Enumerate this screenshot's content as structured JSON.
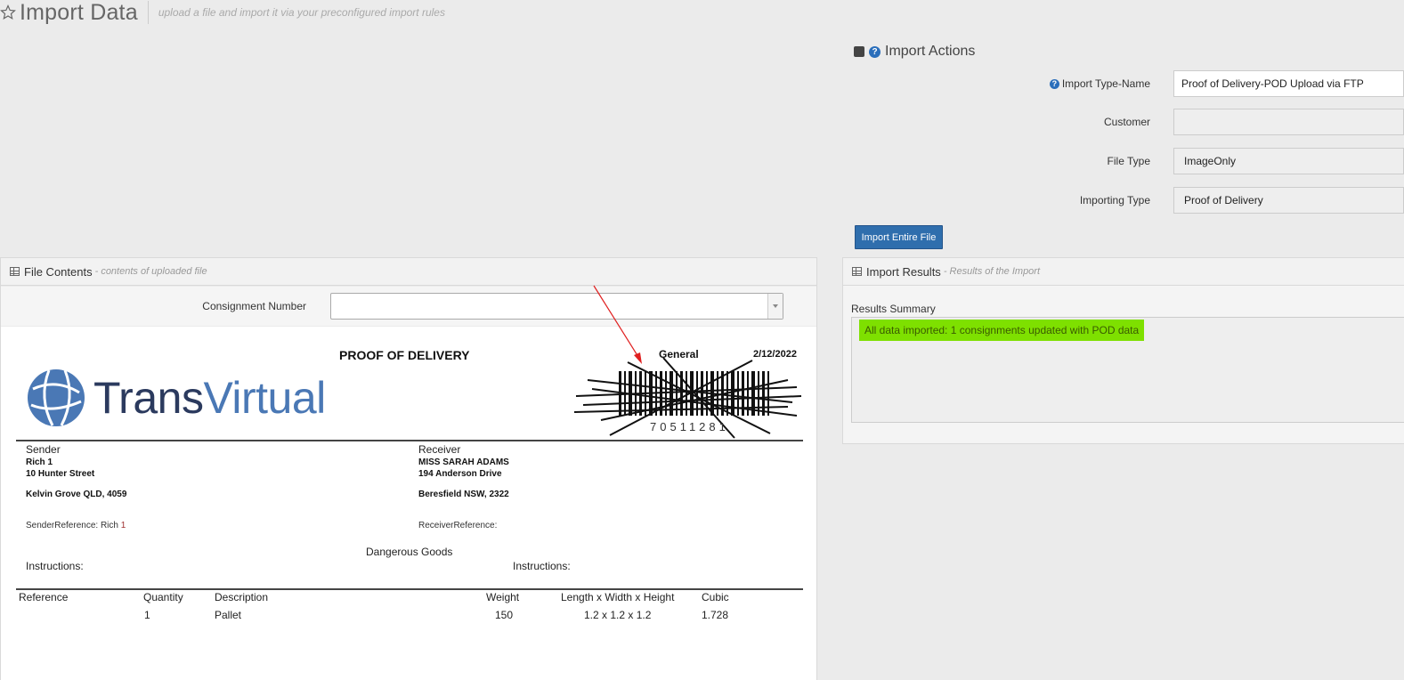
{
  "header": {
    "title": "Import Data",
    "subtitle": "upload a file and import it via your preconfigured import rules"
  },
  "actions": {
    "title": "Import Actions",
    "fields": [
      {
        "label": "Import Type-Name",
        "value": "Proof of Delivery-POD Upload via FTP"
      },
      {
        "label": "Customer",
        "value": ""
      },
      {
        "label": "File Type",
        "value": "ImageOnly"
      },
      {
        "label": "Importing Type",
        "value": "Proof of Delivery"
      }
    ],
    "button": "Import Entire File"
  },
  "file_panel": {
    "title": "File Contents",
    "subtitle": "- contents of uploaded file",
    "consignment_label": "Consignment Number",
    "consignment_value": ""
  },
  "document": {
    "title": "PROOF OF DELIVERY",
    "service": "General",
    "date": "2/12/2022",
    "logo_part1": "Trans",
    "logo_part2": "Virtual",
    "sender_heading": "Sender",
    "sender_name": "Rich 1",
    "sender_address1": "10 Hunter Street",
    "sender_address2": "Kelvin Grove QLD, 4059",
    "sender_ref_label": "SenderReference: Rich ",
    "sender_ref_value": "1",
    "receiver_heading": "Receiver",
    "receiver_name": "MISS SARAH ADAMS",
    "receiver_address1": "194 Anderson Drive",
    "receiver_address2": "Beresfield NSW, 2322",
    "receiver_ref_label": "ReceiverReference:",
    "dangerous_goods": "Dangerous Goods",
    "instructions_left": "Instructions:",
    "instructions_right": "Instructions:",
    "table_headers": [
      "Reference",
      "Quantity",
      "Description",
      "Weight",
      "Length x Width x Height",
      "Cubic"
    ],
    "table_row": [
      "",
      "1",
      "Pallet",
      "150",
      "1.2 x 1.2 x 1.2",
      "1.728"
    ]
  },
  "results_panel": {
    "title": "Import Results",
    "subtitle": "- Results of the Import",
    "summary_label": "Results Summary",
    "message": "All data imported: 1 consignments updated with POD data"
  }
}
